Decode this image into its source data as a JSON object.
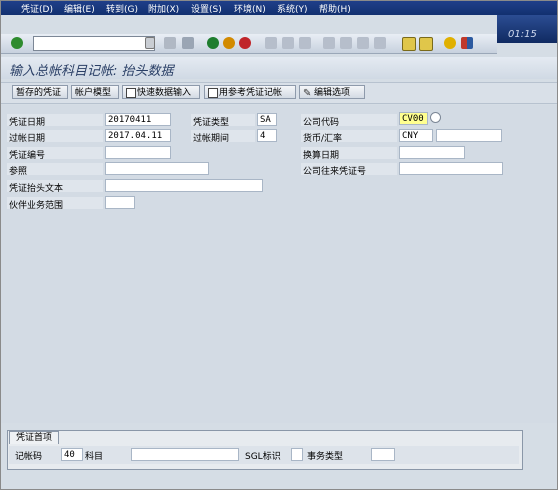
{
  "menu": [
    "凭证(D)",
    "编辑(E)",
    "转到(G)",
    "附加(X)",
    "设置(S)",
    "环境(N)",
    "系统(Y)",
    "帮助(H)"
  ],
  "clock": "01:15",
  "title": "输入总帐科目记帐: 抬头数据",
  "app_toolbar": {
    "b1": "暂存的凭证",
    "b2": "帐户模型",
    "b3": "快速数据输入",
    "b4": "用参考凭证记帐",
    "b5": "编辑选项"
  },
  "form": {
    "doc_date_label": "凭证日期",
    "doc_date": "20170411",
    "post_date_label": "过帐日期",
    "post_date": "2017.04.11",
    "doc_no_label": "凭证编号",
    "ref_label": "参照",
    "header_text_label": "凭证抬头文本",
    "partner_label": "伙伴业务范围",
    "doc_type_label": "凭证类型",
    "doc_type": "SA",
    "period_label": "过帐期间",
    "period": "4",
    "company_label": "公司代码",
    "company": "CV00",
    "currency_label": "货币/汇率",
    "currency": "CNY",
    "translation_date_label": "换算日期",
    "intercompany_label": "公司往来凭证号"
  },
  "bottom": {
    "tab": "凭证首项",
    "posting_key_label": "记帐码",
    "posting_key": "40",
    "account_label": "科目",
    "sgl_label": "SGL标识",
    "trans_type_label": "事务类型"
  }
}
